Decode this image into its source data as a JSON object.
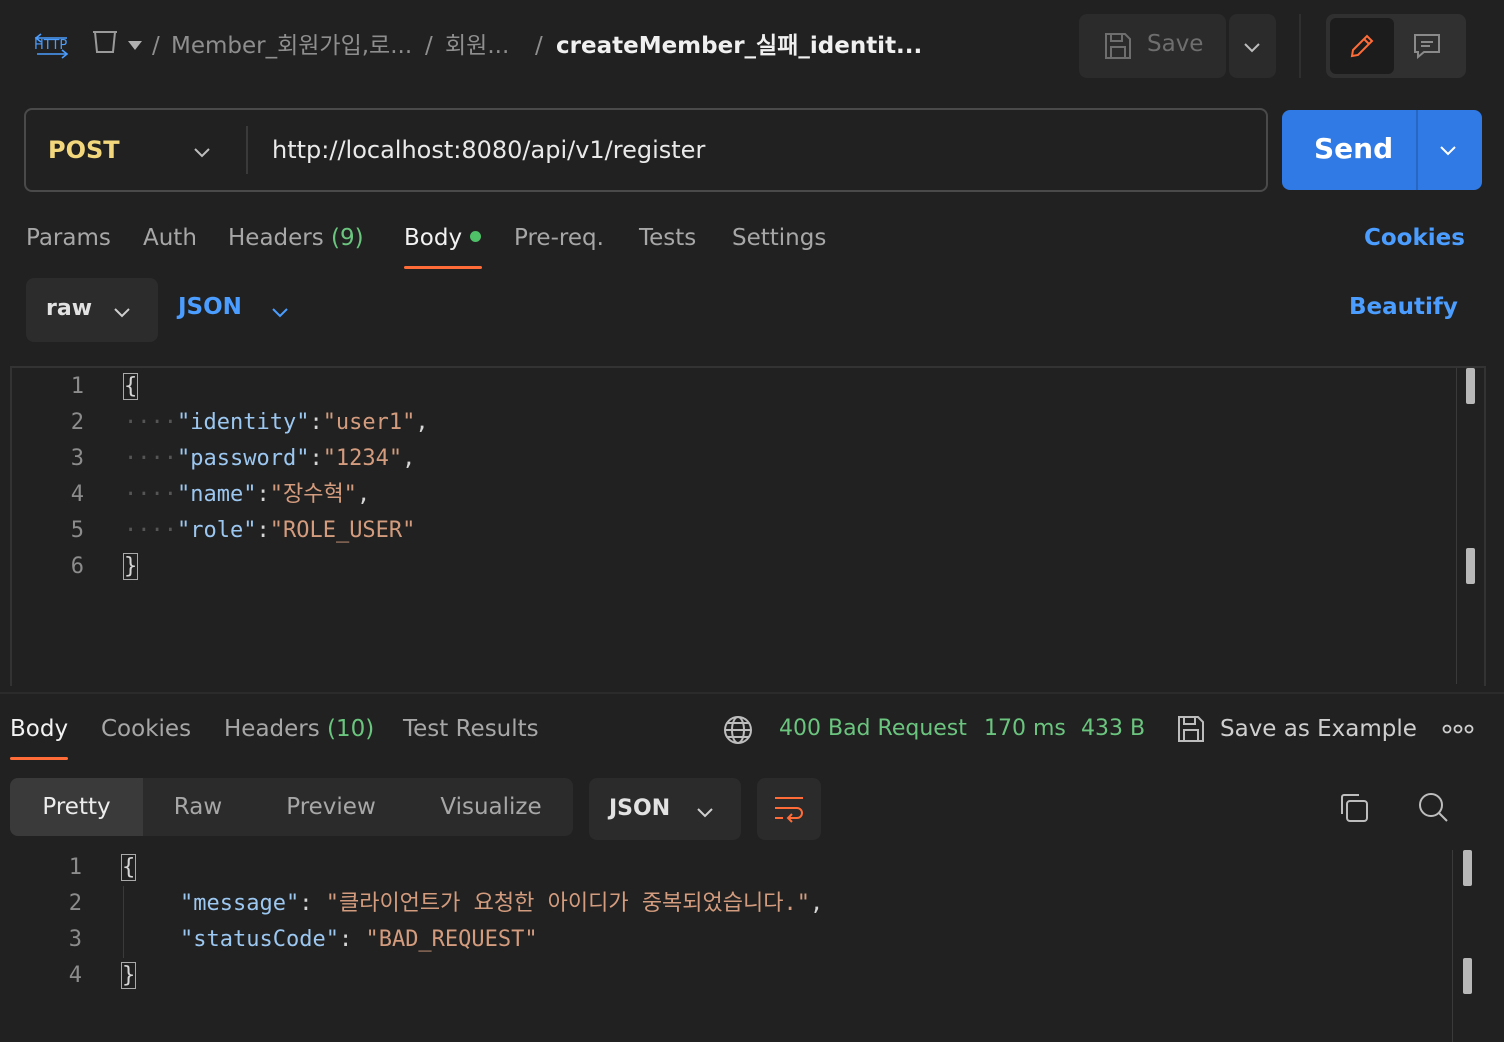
{
  "breadcrumb": {
    "http_badge": "HTTP",
    "collection": "Member_회원가입,로...",
    "folder": "회원...",
    "request": "createMember_실패_identit...",
    "separator": "/"
  },
  "toolbar": {
    "save_label": "Save"
  },
  "request": {
    "method": "POST",
    "url": "http://localhost:8080/api/v1/register",
    "send_label": "Send"
  },
  "request_tabs": {
    "params": "Params",
    "auth": "Auth",
    "headers": "Headers",
    "headers_count": "(9)",
    "body": "Body",
    "prereq": "Pre-req.",
    "tests": "Tests",
    "settings": "Settings",
    "cookies": "Cookies"
  },
  "body_options": {
    "mode": "raw",
    "language": "JSON",
    "beautify": "Beautify"
  },
  "request_body": {
    "line_numbers": [
      "1",
      "2",
      "3",
      "4",
      "5",
      "6"
    ],
    "open_brace": "{",
    "close_brace": "}",
    "fields": [
      {
        "key": "\"identity\"",
        "value": "\"user1\"",
        "trail": ","
      },
      {
        "key": "\"password\"",
        "value": "\"1234\"",
        "trail": ","
      },
      {
        "key": "\"name\"",
        "value": "\"장수혁\"",
        "trail": ","
      },
      {
        "key": "\"role\"",
        "value": "\"ROLE_USER\"",
        "trail": ""
      }
    ]
  },
  "response_tabs": {
    "body": "Body",
    "cookies": "Cookies",
    "headers": "Headers",
    "headers_count": "(10)",
    "test_results": "Test Results"
  },
  "response_status": {
    "status": "400 Bad Request",
    "time": "170 ms",
    "size": "433 B",
    "save_as_example": "Save as Example"
  },
  "response_view": {
    "pretty": "Pretty",
    "raw": "Raw",
    "preview": "Preview",
    "visualize": "Visualize",
    "language": "JSON"
  },
  "response_body": {
    "line_numbers": [
      "1",
      "2",
      "3",
      "4"
    ],
    "open_brace": "{",
    "close_brace": "}",
    "fields": [
      {
        "key": "\"message\"",
        "value": "\"클라이언트가 요청한 아이디가 중복되었습니다.\"",
        "trail": ","
      },
      {
        "key": "\"statusCode\"",
        "value": "\"BAD_REQUEST\"",
        "trail": ""
      }
    ]
  },
  "colors": {
    "accent_orange": "#ff6c37",
    "send_blue": "#2f7ae5",
    "link_blue": "#4b9dff",
    "status_green": "#6bc57f",
    "method_yellow": "#f2d77c"
  }
}
